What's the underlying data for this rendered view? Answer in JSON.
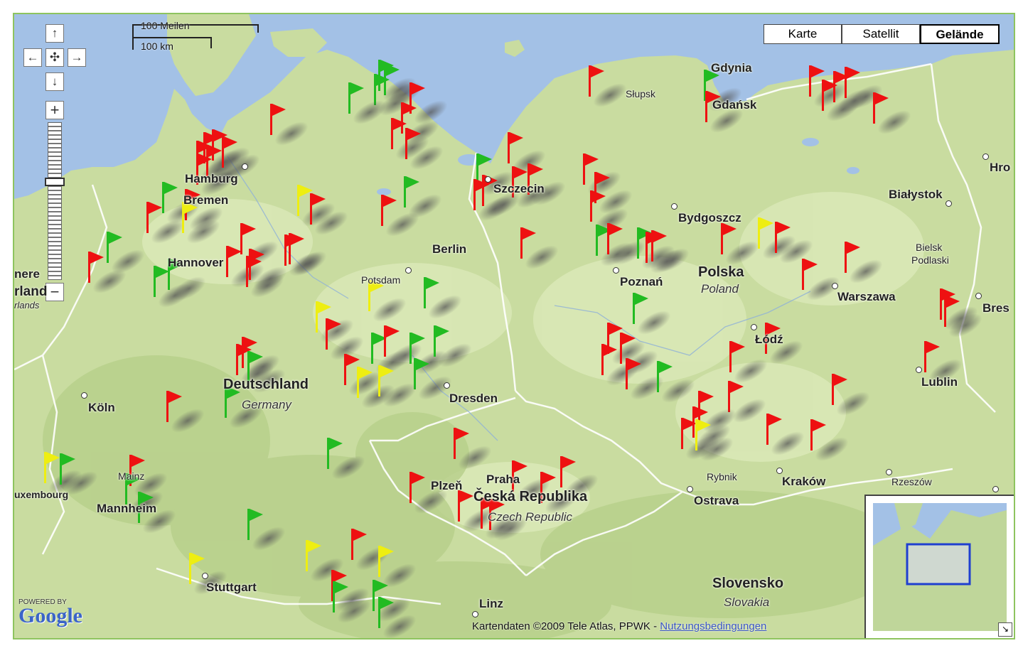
{
  "map": {
    "type_buttons": [
      {
        "label": "Karte",
        "active": false
      },
      {
        "label": "Satellit",
        "active": false
      },
      {
        "label": "Gelände",
        "active": true
      }
    ],
    "scale": {
      "miles": "100 Meilen",
      "km": "100 km"
    },
    "zoom_controls": {
      "zoom_in": "+",
      "zoom_out": "−",
      "zoom_level_fraction": 0.35
    },
    "attribution": "Kartendaten ©2009 Tele Atlas, PPWK -",
    "terms_link": "Nutzungsbedingungen",
    "logo": {
      "powered_by": "POWERED BY",
      "brand": "Google"
    },
    "colors": {
      "water": "#a3c1e6",
      "land": "#c9dca0",
      "border": "#ffffff",
      "flag_red": "#ee1111",
      "flag_green": "#22bb22",
      "flag_yellow": "#eeee11"
    }
  },
  "places": {
    "gdynia": "Gdynia",
    "slupsk": "Słupsk",
    "gdansk": "Gdańsk",
    "hrodna": "Hro",
    "hamburg": "Hamburg",
    "bremen": "Bremen",
    "szczecin": "Szczecin",
    "bialystok": "Białystok",
    "bydgoszcz": "Bydgoszcz",
    "berlin": "Berlin",
    "hannover": "Hannover",
    "bielsk1": "Bielsk",
    "bielsk2": "Podlaski",
    "potsdam": "Potsdam",
    "poznan": "Poznań",
    "warszawa": "Warszawa",
    "brest": "Bres",
    "nl1": "nere",
    "nl2": "rland",
    "nl3": "rlands",
    "lodz": "Łódź",
    "lublin": "Lublin",
    "koln": "Köln",
    "dresden": "Dresden",
    "mainz": "Mainz",
    "luxembourg": "uxembourg",
    "mannheim": "Mannheim",
    "plzen": "Plzeň",
    "praha": "Praha",
    "rybnik": "Rybnik",
    "krakow": "Kraków",
    "rzeszow": "Rzeszów",
    "ostrava": "Ostrava",
    "stuttgart": "Stuttgart",
    "linz": "Linz"
  },
  "countries": {
    "germany": {
      "name": "Deutschland",
      "sub": "Germany"
    },
    "poland": {
      "name": "Polska",
      "sub": "Poland"
    },
    "czech": {
      "name": "Česká Republika",
      "sub": "Czech Republic"
    },
    "slovakia": {
      "name": "Slovensko",
      "sub": "Slovakia"
    }
  }
}
